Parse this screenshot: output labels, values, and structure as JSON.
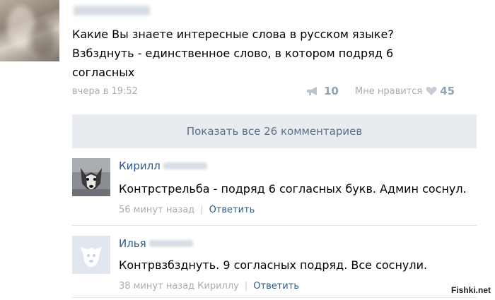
{
  "post": {
    "text_line1": "Какие Вы знаете интересные слова в русском языке?",
    "text_line2": "Взбзднуть - единственное слово, в котором подряд 6",
    "text_line3": "согласных",
    "date": "вчера в 19:52",
    "share_count": "10",
    "like_label": "Мне нравится",
    "like_count": "45"
  },
  "show_all_label": "Показать все 26 комментариев",
  "comments": [
    {
      "name": "Кирилл",
      "text": "Контрстрельба - подряд 6 согласных букв. Админ соснул.",
      "time": "56 минут назад",
      "reply_label": "Ответить"
    },
    {
      "name": "Илья",
      "text": "Контрвзбзднуть. 9 согласных подряд. Все соснули.",
      "time": "38 минут назад",
      "reply_to": "Кириллу",
      "reply_label": "Ответить"
    }
  ],
  "watermark": "Fishki.net",
  "colors": {
    "link": "#2f5a8a",
    "meta": "#a8adb3",
    "bar_bg": "#e8ecf1",
    "count": "#8fa3b8"
  }
}
